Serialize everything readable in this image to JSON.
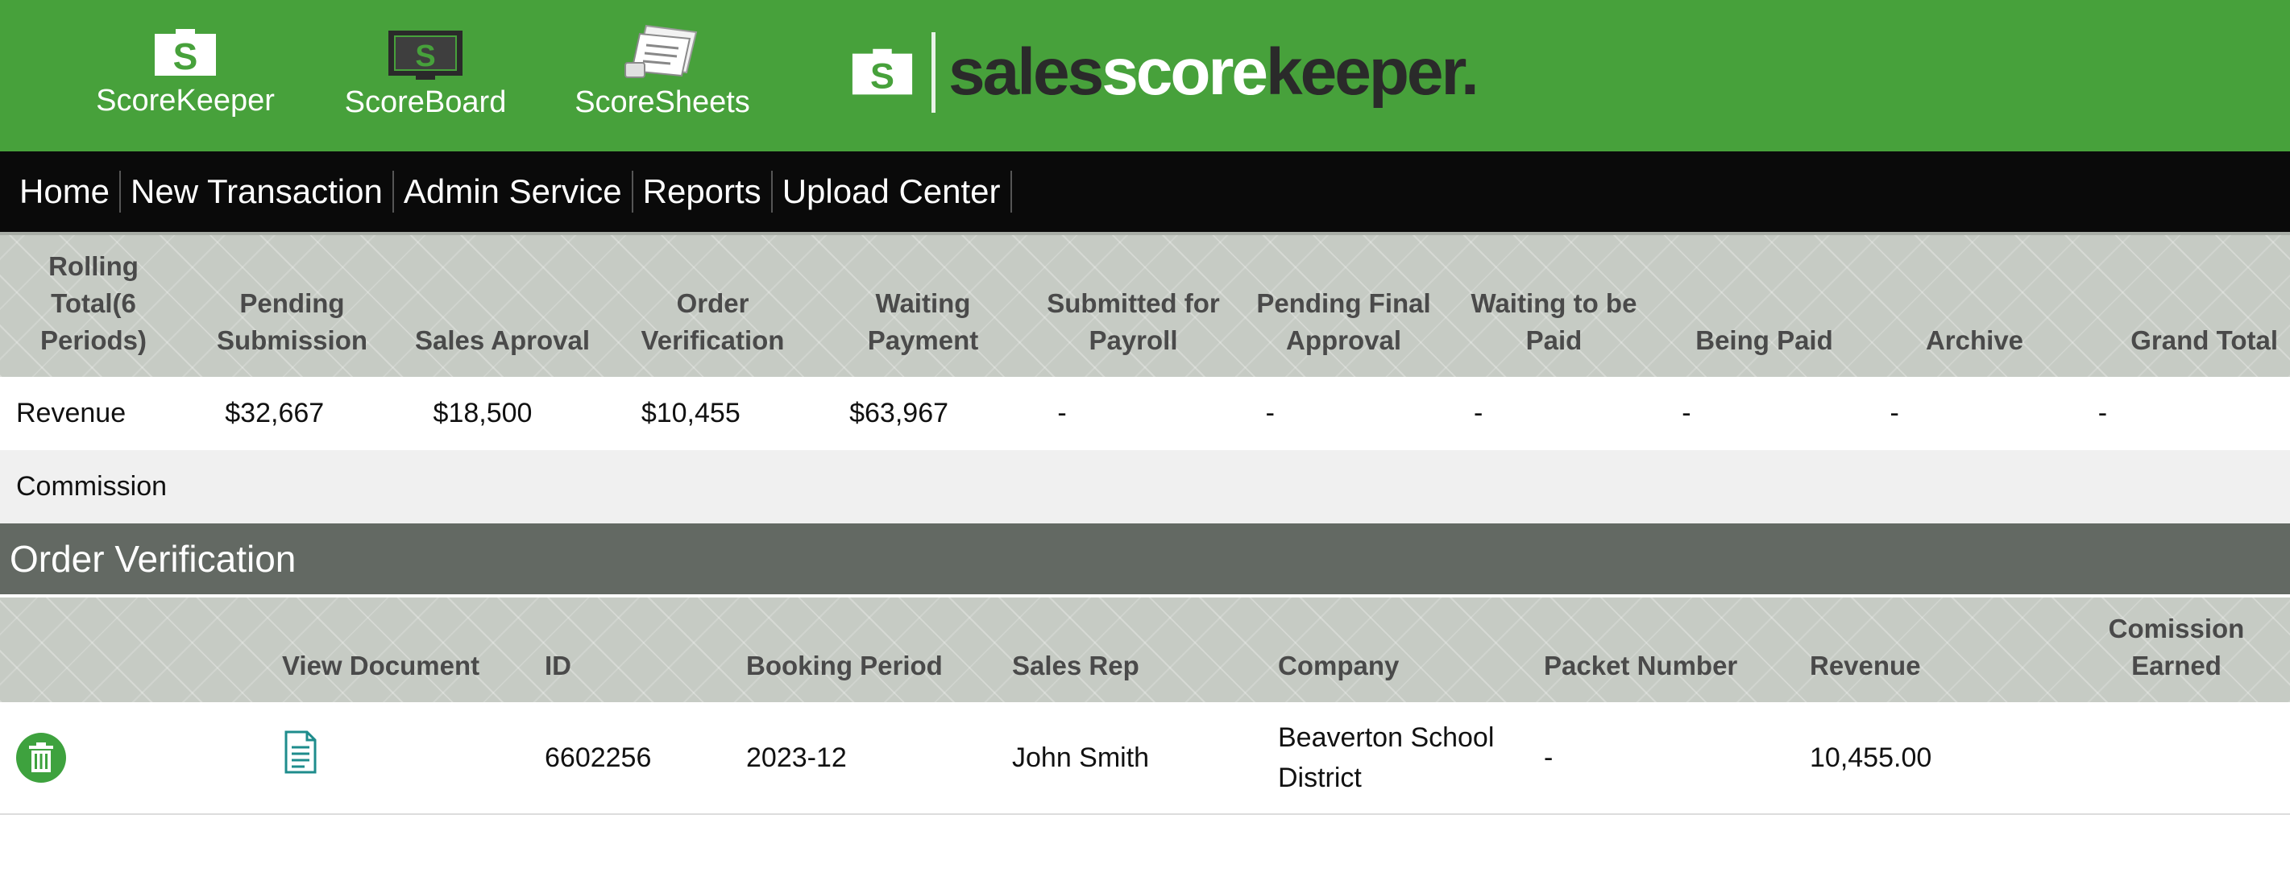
{
  "header": {
    "apps": [
      {
        "label": "ScoreKeeper",
        "icon": "scorekeeper-logo-icon"
      },
      {
        "label": "ScoreBoard",
        "icon": "scoreboard-monitor-icon"
      },
      {
        "label": "ScoreSheets",
        "icon": "scoresheets-icon"
      }
    ],
    "brand": {
      "part1": "sales",
      "part2": "score",
      "part3": "keeper",
      "suffix": "."
    }
  },
  "nav": [
    "Home",
    "New Transaction",
    "Admin Service",
    "Reports",
    "Upload Center"
  ],
  "summary": {
    "headers": [
      "Rolling Total(6 Periods)",
      "Pending Submission",
      "Sales Aproval",
      "Order Verification",
      "Waiting Payment",
      "Submitted for Payroll",
      "Pending Final Approval",
      "Waiting to be Paid",
      "Being Paid",
      "Archive",
      "Grand Total"
    ],
    "revenue": [
      "Revenue",
      "$32,667",
      "$18,500",
      "$10,455",
      "$63,967",
      "-",
      "-",
      "-",
      "-",
      "-",
      "-"
    ],
    "commission": [
      "Commission"
    ]
  },
  "section_title": "Order Verification",
  "detail": {
    "headers": {
      "view_document": "View Document",
      "id": "ID",
      "booking_period": "Booking Period",
      "sales_rep": "Sales Rep",
      "company": "Company",
      "packet_number": "Packet Number",
      "revenue": "Revenue",
      "commission_earned": "Comission Earned"
    },
    "rows": [
      {
        "id": "6602256",
        "booking_period": "2023-12",
        "sales_rep": "John Smith",
        "company": "Beaverton School District",
        "packet_number": "-",
        "revenue": "10,455.00",
        "commission_earned": ""
      }
    ]
  },
  "colors": {
    "brand_green": "#47a13b",
    "nav_black": "#0a0a0a",
    "section_gray": "#636963",
    "header_gray": "#c6cbc4",
    "action_green": "#3ea23e",
    "doc_teal": "#1e8c8c"
  }
}
